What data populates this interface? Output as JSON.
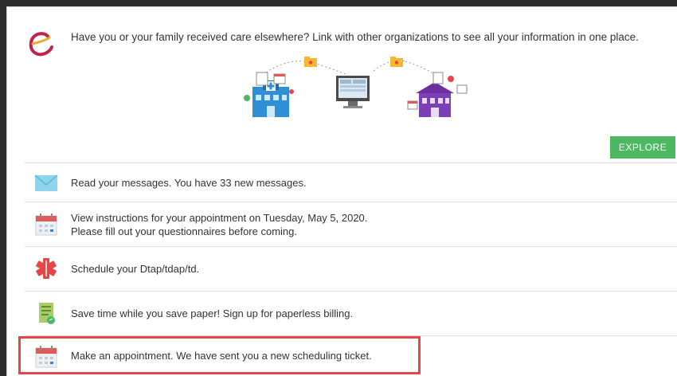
{
  "intro": {
    "text": "Have you or your family received care elsewhere? Link with other organizations to see all your information in one place."
  },
  "explore_label": "EXPLORE",
  "rows": [
    {
      "icon": "envelope-icon",
      "line1": "Read your messages. You have 33 new messages.",
      "line2": ""
    },
    {
      "icon": "calendar-icon",
      "line1": "View instructions for your appointment on Tuesday, May 5, 2020.",
      "line2": "Please fill out your questionnaires before coming."
    },
    {
      "icon": "medical-star-icon",
      "line1": "Schedule your Dtap/tdap/td.",
      "line2": ""
    },
    {
      "icon": "paperless-bill-icon",
      "line1": "Save time while you save paper! Sign up for paperless billing.",
      "line2": ""
    },
    {
      "icon": "calendar-icon",
      "line1": "Make an appointment. We have sent you a new scheduling ticket.",
      "line2": ""
    }
  ],
  "colors": {
    "accent_green": "#4cb861",
    "highlight_red": "#e24848",
    "calendar_red": "#e05a5a",
    "envelope_blue": "#8fd4ea"
  }
}
